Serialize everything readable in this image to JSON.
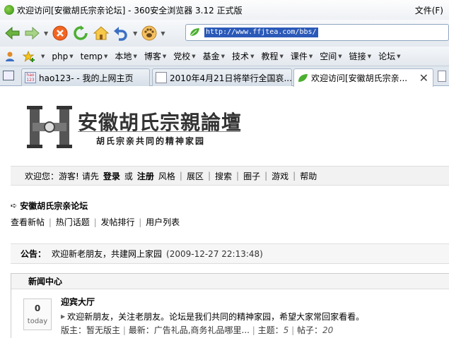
{
  "window": {
    "title": "欢迎访问[安徽胡氏宗亲论坛] - 360安全浏览器 3.12 正式版",
    "menu_file": "文件(F)"
  },
  "address": {
    "url": "http://www.ffjtea.com/bbs/"
  },
  "favorites": {
    "items": [
      "php",
      "temp",
      "本地",
      "博客",
      "党校",
      "基金",
      "技术",
      "教程",
      "课件",
      "空间",
      "链接",
      "论坛"
    ]
  },
  "tabs": [
    {
      "label": "hao123- - 我的上网主页",
      "icon": "hao123-icon"
    },
    {
      "label": "2010年4月21日将举行全国哀...",
      "icon": "page-icon"
    },
    {
      "label": "欢迎访问[安徽胡氏宗亲...",
      "icon": "leaf-icon"
    }
  ],
  "forum": {
    "title": "安徽胡氏宗親論壇",
    "slogan": "胡氏宗亲共同的精神家园"
  },
  "userbar": {
    "welcome": "欢迎您：游客!",
    "please": "请先",
    "login": "登录",
    "or": "或",
    "register": "注册",
    "links": [
      "风格",
      "展区",
      "搜索",
      "圈子",
      "游戏",
      "帮助"
    ]
  },
  "breadcrumb": {
    "label": "安徽胡氏宗亲论坛"
  },
  "quicklinks": [
    "查看新帖",
    "热门话题",
    "发帖排行",
    "用户列表"
  ],
  "notice": {
    "label": "公告：",
    "text": "欢迎新老朋友，共建网上家园",
    "time": "(2009-12-27 22:13:48)"
  },
  "section": {
    "title": "新闻中心",
    "forum_name": "迎宾大厅",
    "today_count": "0",
    "today_label": "today",
    "description": "欢迎新朋友，关注老朋友。论坛是我们共同的精神家园，希望大家常回家看看。",
    "moderator": "版主：暂无版主",
    "latest": "最新：广告礼品,商务礼品哪里...",
    "topics_label": "主题：",
    "topics": "5",
    "posts_label": "帖子：",
    "posts": "20"
  }
}
